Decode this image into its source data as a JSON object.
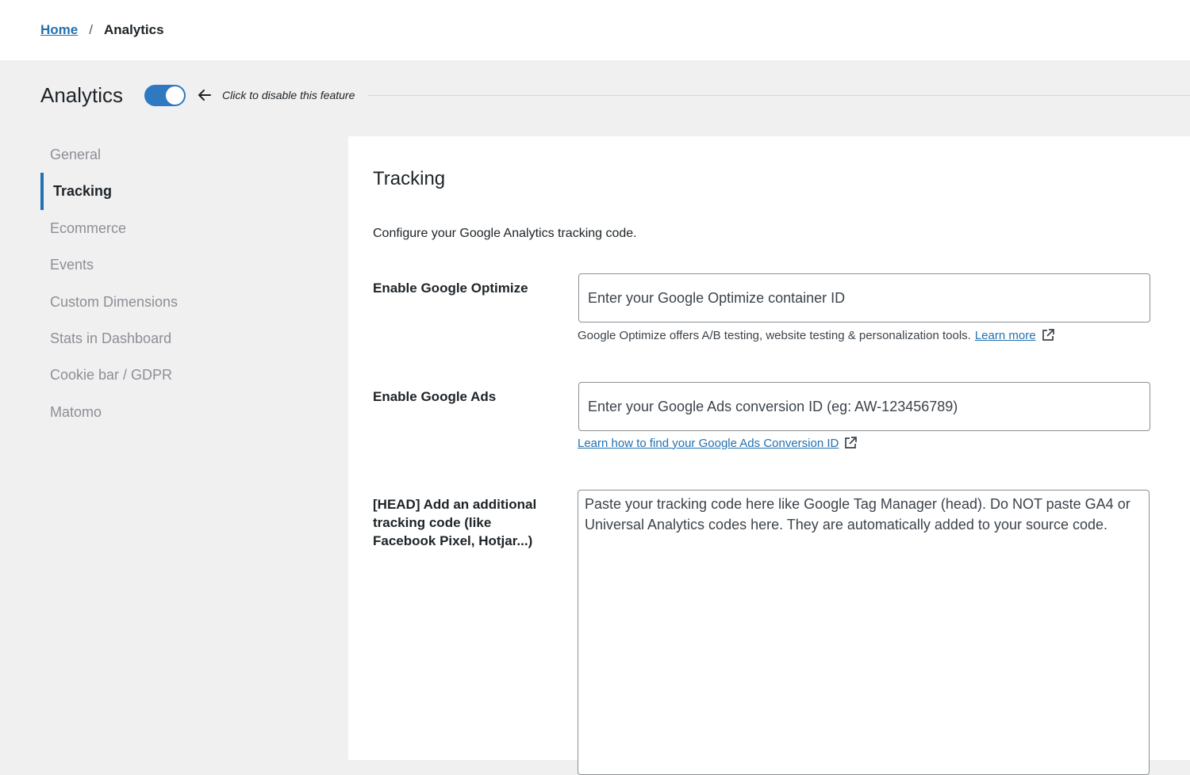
{
  "breadcrumb": {
    "home": "Home",
    "separator": "/",
    "current": "Analytics"
  },
  "header": {
    "title": "Analytics",
    "toggle_on": true,
    "hint": "Click to disable this feature"
  },
  "sidebar": {
    "items": [
      {
        "label": "General",
        "active": false
      },
      {
        "label": "Tracking",
        "active": true
      },
      {
        "label": "Ecommerce",
        "active": false
      },
      {
        "label": "Events",
        "active": false
      },
      {
        "label": "Custom Dimensions",
        "active": false
      },
      {
        "label": "Stats in Dashboard",
        "active": false
      },
      {
        "label": "Cookie bar / GDPR",
        "active": false
      },
      {
        "label": "Matomo",
        "active": false
      }
    ]
  },
  "panel": {
    "title": "Tracking",
    "description": "Configure your Google Analytics tracking code.",
    "optimize": {
      "label": "Enable Google Optimize",
      "placeholder": "Enter your Google Optimize container ID",
      "value": "",
      "help": "Google Optimize offers A/B testing, website testing & personalization tools.",
      "link": "Learn more"
    },
    "ads": {
      "label": "Enable Google Ads",
      "placeholder": "Enter your Google Ads conversion ID (eg: AW-123456789)",
      "value": "",
      "link": "Learn how to find your Google Ads Conversion ID"
    },
    "head_code": {
      "label": "[HEAD] Add an additional tracking code (like Facebook Pixel, Hotjar...)",
      "placeholder": "Paste your tracking code here like Google Tag Manager (head). Do NOT paste GA4 or Universal Analytics codes here. They are automatically added to your source code.",
      "value": ""
    }
  },
  "colors": {
    "accent": "#2271b1",
    "toggle": "#2f78c2",
    "background": "#f0f0f1"
  },
  "icons": {
    "back": "arrow-left-icon",
    "external": "external-link-icon"
  }
}
